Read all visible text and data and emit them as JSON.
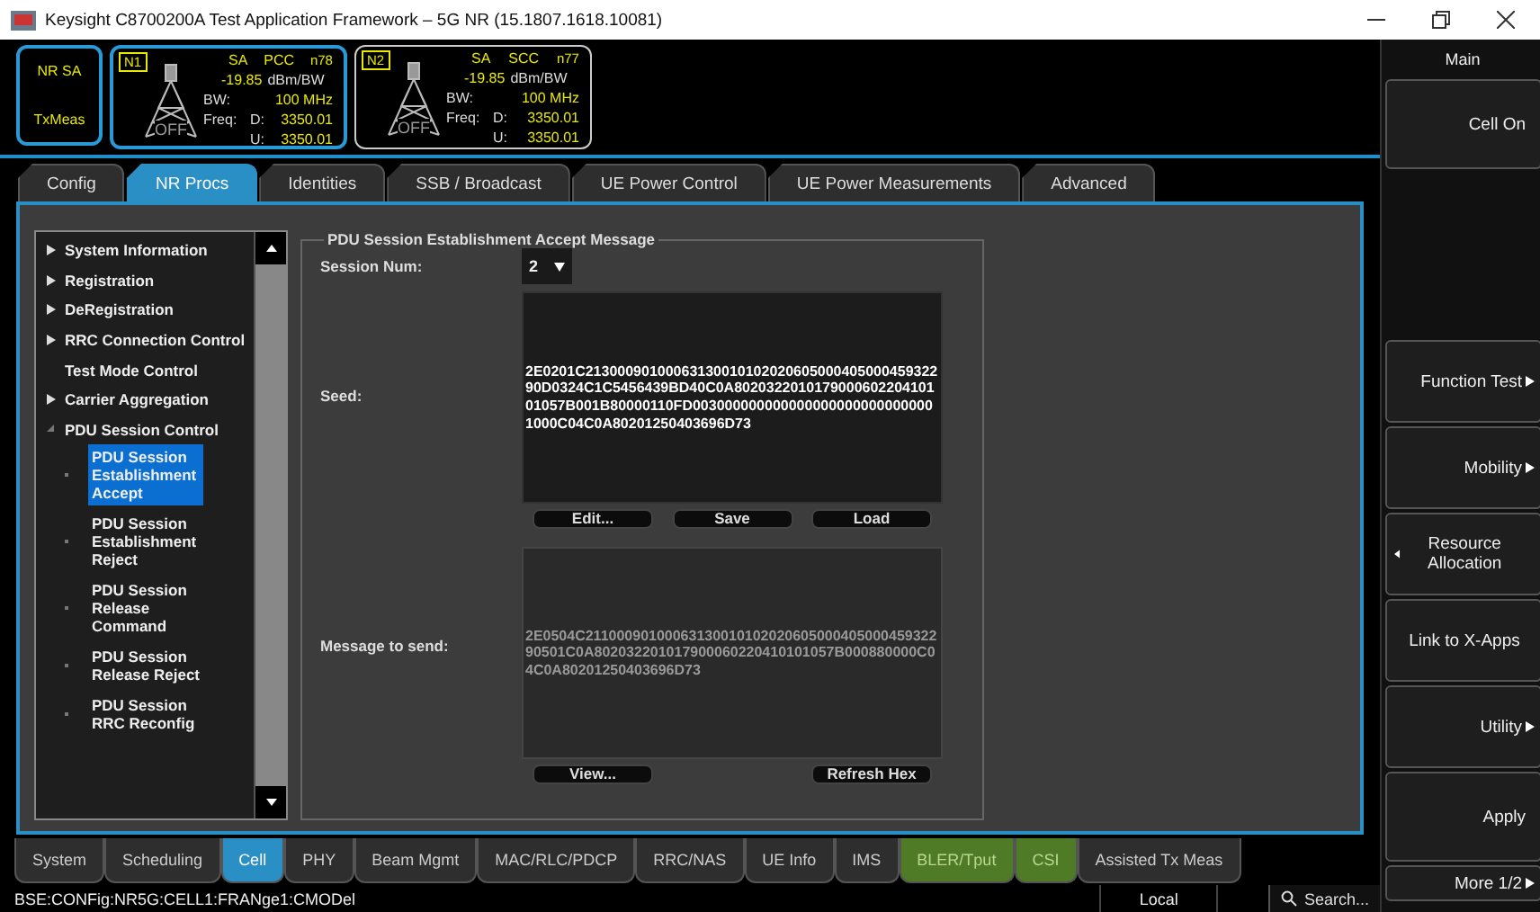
{
  "window": {
    "title": "Keysight C8700200A Test Application Framework – 5G NR (15.1807.1618.10081)"
  },
  "mode": {
    "line1": "NR SA",
    "line2": "TxMeas"
  },
  "cells": [
    {
      "label": "N1",
      "selected": true,
      "mode": "SA",
      "role": "PCC",
      "band": "n78",
      "power": "-19.85",
      "unit": "dBm/BW",
      "bw_label": "BW:",
      "bw": "100 MHz",
      "freq_label": "Freq:",
      "d_label": "D:",
      "d": "3350.01",
      "u_label": "U:",
      "u": "3350.01",
      "state": "OFF"
    },
    {
      "label": "N2",
      "selected": false,
      "mode": "SA",
      "role": "SCC",
      "band": "n77",
      "power": "-19.85",
      "unit": "dBm/BW",
      "bw_label": "BW:",
      "bw": "100 MHz",
      "freq_label": "Freq:",
      "d_label": "D:",
      "d": "3350.01",
      "u_label": "U:",
      "u": "3350.01",
      "state": "OFF"
    }
  ],
  "tabs": [
    {
      "label": "Config",
      "selected": false
    },
    {
      "label": "NR Procs",
      "selected": true
    },
    {
      "label": "Identities",
      "selected": false
    },
    {
      "label": "SSB / Broadcast",
      "selected": false
    },
    {
      "label": "UE Power Control",
      "selected": false
    },
    {
      "label": "UE Power Measurements",
      "selected": false
    },
    {
      "label": "Advanced",
      "selected": false
    }
  ],
  "tree": [
    {
      "label": "System Information",
      "kind": "branch",
      "expanded": false
    },
    {
      "label": "Registration",
      "kind": "branch",
      "expanded": false
    },
    {
      "label": "DeRegistration",
      "kind": "branch",
      "expanded": false
    },
    {
      "label": "RRC Connection Control",
      "kind": "branch",
      "expanded": false
    },
    {
      "label": "Test Mode Control",
      "kind": "leaf"
    },
    {
      "label": "Carrier Aggregation",
      "kind": "branch",
      "expanded": false
    },
    {
      "label": "PDU Session Control",
      "kind": "branch",
      "expanded": true,
      "children": [
        {
          "label": "PDU Session Establishment Accept",
          "selected": true
        },
        {
          "label": "PDU Session Establishment Reject",
          "selected": false
        },
        {
          "label": "PDU Session Release Command",
          "selected": false
        },
        {
          "label": "PDU Session Release Reject",
          "selected": false
        },
        {
          "label": "PDU Session RRC Reconfig",
          "selected": false
        }
      ]
    }
  ],
  "form": {
    "title": "PDU Session Establishment Accept Message",
    "session_label": "Session Num:",
    "session_value": "2",
    "seed_label": "Seed:",
    "seed": "2E0201C2130009010006313001010202060500040500045932290D0324C1C5456439BD40C0A802032201017900060220410101057B001B80000110FD0030000000000000000000000000001000C04C0A80201250403696D73",
    "seed_buttons": [
      "Edit...",
      "Save",
      "Load"
    ],
    "message_label": "Message to send:",
    "message": "2E0504C2110009010006313001010202060500040500045932290501C0A802032201017900060220410101057B000880000C04C0A80201250403696D73",
    "message_buttons": [
      "View...",
      "Refresh Hex"
    ]
  },
  "bottom_tabs": [
    {
      "label": "System",
      "selected": false,
      "kind": "normal"
    },
    {
      "label": "Scheduling",
      "selected": false,
      "kind": "normal"
    },
    {
      "label": "Cell",
      "selected": true,
      "kind": "normal"
    },
    {
      "label": "PHY",
      "selected": false,
      "kind": "normal"
    },
    {
      "label": "Beam Mgmt",
      "selected": false,
      "kind": "normal"
    },
    {
      "label": "MAC/RLC/PDCP",
      "selected": false,
      "kind": "normal"
    },
    {
      "label": "RRC/NAS",
      "selected": false,
      "kind": "normal"
    },
    {
      "label": "UE Info",
      "selected": false,
      "kind": "normal"
    },
    {
      "label": "IMS",
      "selected": false,
      "kind": "normal"
    },
    {
      "label": "BLER/Tput",
      "selected": false,
      "kind": "green"
    },
    {
      "label": "CSI",
      "selected": false,
      "kind": "green"
    },
    {
      "label": "Assisted Tx Meas",
      "selected": false,
      "kind": "normal"
    }
  ],
  "status_bar": {
    "command": "BSE:CONFig:NR5G:CELL1:FRANge1:CMODel",
    "mode": "Local",
    "search": "Search..."
  },
  "side_panel": {
    "title": "Main",
    "buttons": [
      {
        "label": "Cell On",
        "kind": "plain"
      },
      {
        "label": "Function Test",
        "kind": "submenu"
      },
      {
        "label": "Mobility",
        "kind": "submenu"
      },
      {
        "label": "Resource Allocation",
        "kind": "back"
      },
      {
        "label": "Link to X-Apps",
        "kind": "center"
      },
      {
        "label": "Utility",
        "kind": "submenu"
      },
      {
        "label": "Apply",
        "kind": "plain"
      },
      {
        "label": "More 1/2",
        "kind": "submenu"
      }
    ]
  }
}
